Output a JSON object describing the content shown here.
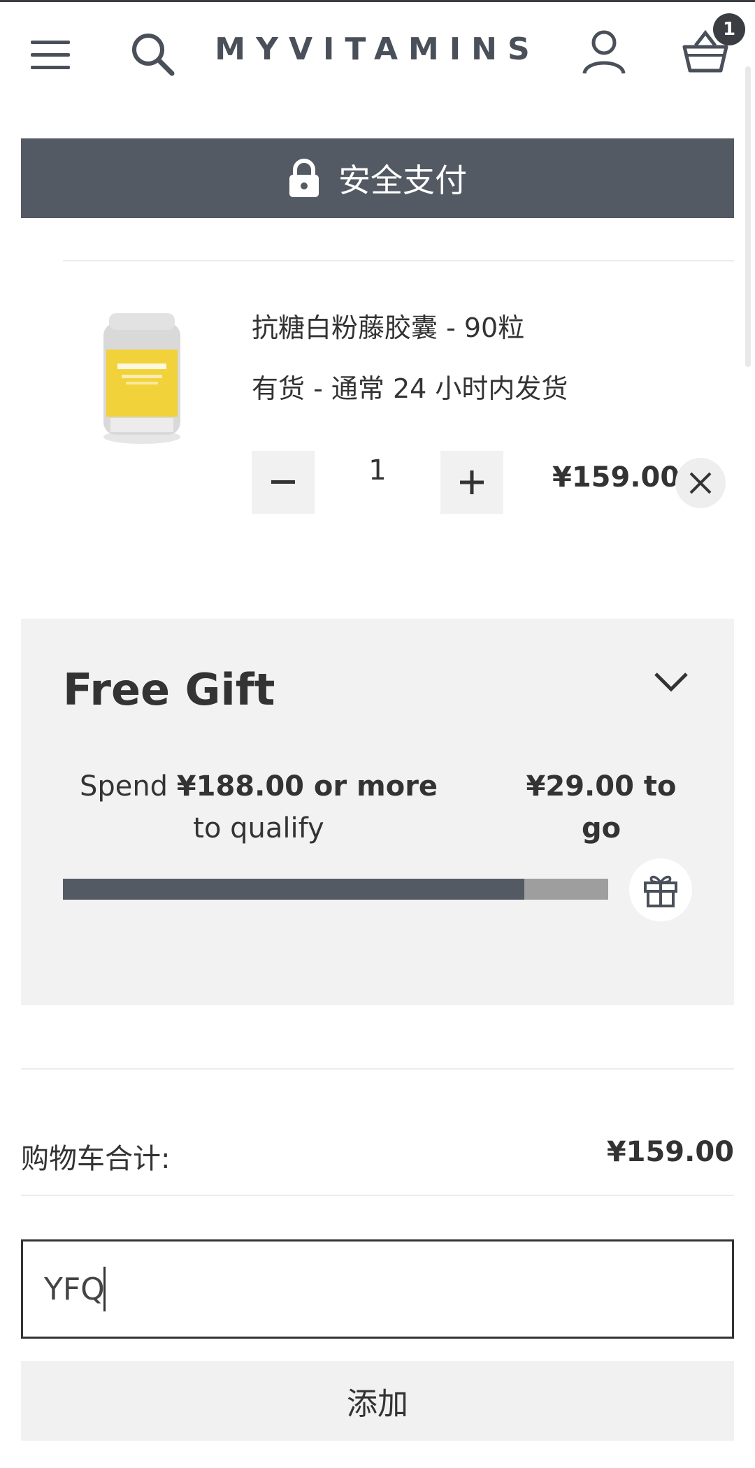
{
  "header": {
    "logo": "MYVITAMINS",
    "basket_count": "1"
  },
  "secure_banner": {
    "label": "安全支付"
  },
  "cart_item": {
    "name": "抗糖白粉藤胶囊 - 90粒",
    "stock": "有货  -  通常 24 小时内发货",
    "quantity": "1",
    "price": "¥159.00",
    "image_icon": "supplement-bottle"
  },
  "free_gift": {
    "title": "Free Gift",
    "spend_prefix": "Spend ",
    "spend_threshold": "¥188.00 or more",
    "spend_suffix": " to qualify",
    "remaining": "¥29.00 to go",
    "progress_fraction": 0.846,
    "icon": "gift-icon"
  },
  "summary": {
    "subtotal_label": "购物车合计:",
    "subtotal_value": "¥159.00"
  },
  "promo": {
    "input_value": "YFQ",
    "add_label": "添加"
  },
  "colors": {
    "banner": "#545a63",
    "panel": "#f2f2f2",
    "product_yellow": "#f2d23a"
  }
}
